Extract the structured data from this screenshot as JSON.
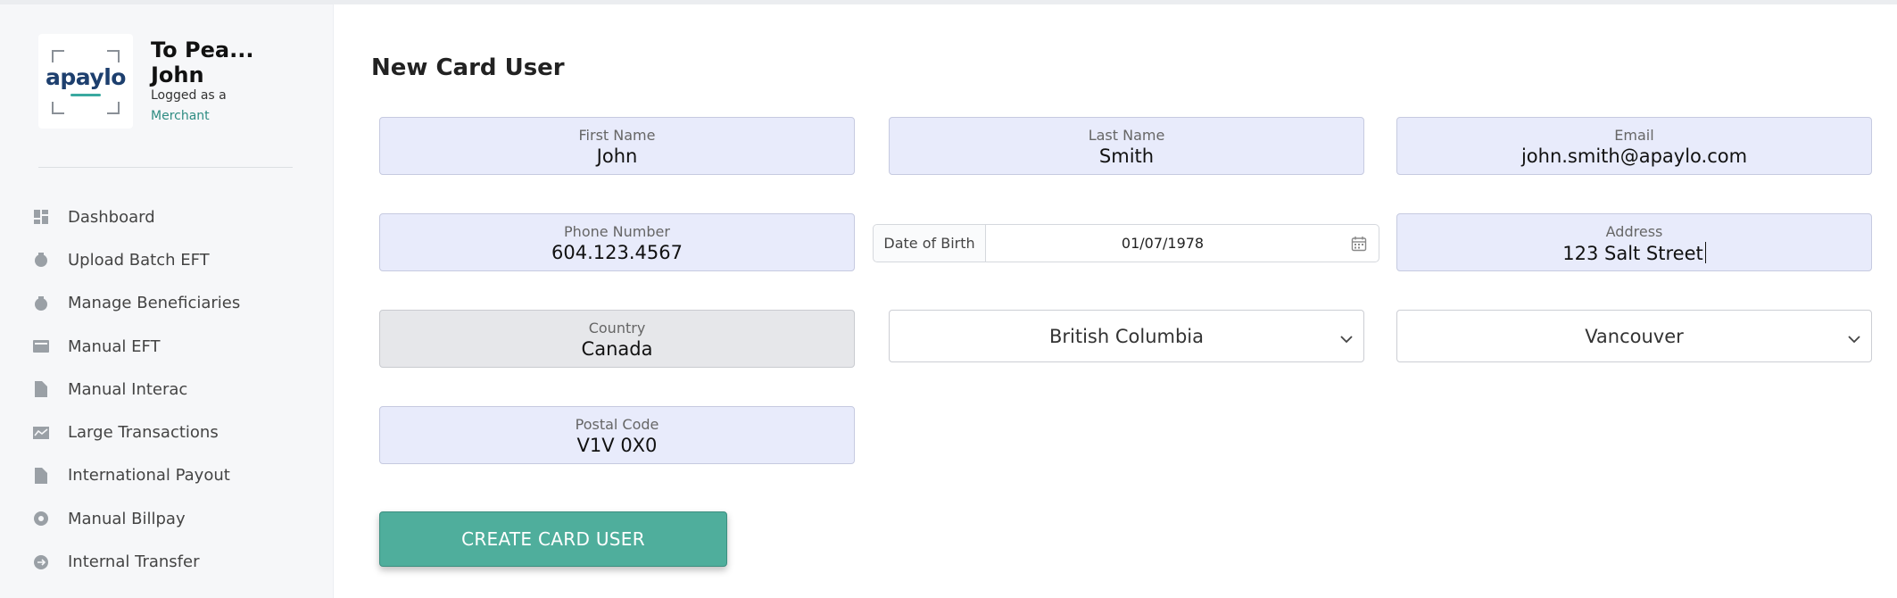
{
  "brand": {
    "logo_text": "apaylo",
    "accent": "#4fae9c",
    "field_bg": "#e8ebfb"
  },
  "account": {
    "merchant_name_line1": "To Pea...",
    "merchant_name_line2": "John",
    "logged_in_label": "Logged as a",
    "role": "Merchant"
  },
  "sidebar": {
    "items": [
      {
        "label": "Dashboard",
        "icon": "dashboard-icon"
      },
      {
        "label": "Upload Batch EFT",
        "icon": "upload-icon"
      },
      {
        "label": "Manage Beneficiaries",
        "icon": "users-icon"
      },
      {
        "label": "Manual EFT",
        "icon": "card-icon"
      },
      {
        "label": "Manual Interac",
        "icon": "document-icon"
      },
      {
        "label": "Large Transactions",
        "icon": "chart-icon"
      },
      {
        "label": "International Payout",
        "icon": "document-icon"
      },
      {
        "label": "Manual Billpay",
        "icon": "bill-icon"
      },
      {
        "label": "Internal Transfer",
        "icon": "transfer-icon"
      }
    ]
  },
  "form": {
    "title": "New Card User",
    "first_name": {
      "label": "First Name",
      "value": "John"
    },
    "last_name": {
      "label": "Last Name",
      "value": "Smith"
    },
    "email": {
      "label": "Email",
      "value": "john.smith@apaylo.com"
    },
    "phone": {
      "label": "Phone Number",
      "value": "604.123.4567"
    },
    "dob": {
      "label": "Date of Birth",
      "value": "01/07/1978"
    },
    "address": {
      "label": "Address",
      "value": "123 Salt Street"
    },
    "country": {
      "label": "Country",
      "value": "Canada"
    },
    "province": {
      "value": "British Columbia"
    },
    "city": {
      "value": "Vancouver"
    },
    "postal_code": {
      "label": "Postal Code",
      "value": "V1V 0X0"
    },
    "submit_label": "CREATE CARD USER"
  }
}
